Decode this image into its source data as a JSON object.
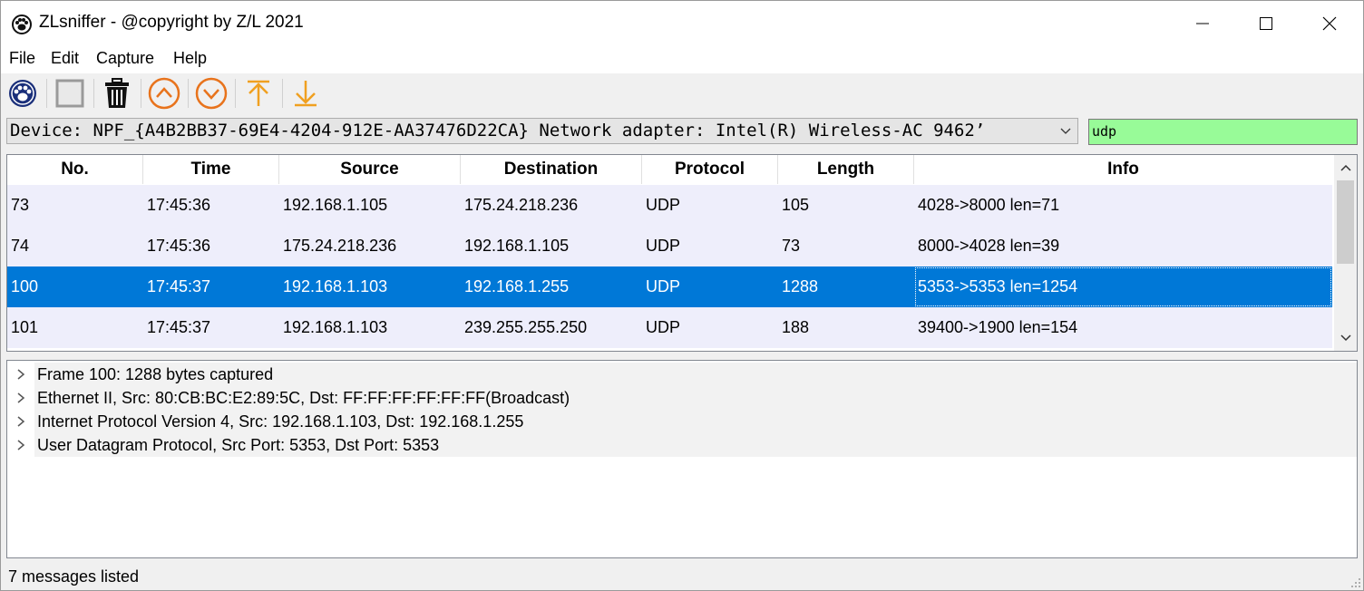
{
  "window": {
    "title": "ZLsniffer - @copyright by Z/L 2021",
    "app_icon": "paw-icon"
  },
  "menu": [
    "File",
    "Edit",
    "Capture",
    "Help"
  ],
  "toolbar": {
    "buttons": [
      "start-capture-icon",
      "stop-capture-icon",
      "trash-icon",
      "previous-packet-icon",
      "next-packet-icon",
      "first-packet-icon",
      "last-packet-icon"
    ],
    "colors": {
      "orange": "#e8731c",
      "amber": "#f0a020",
      "navy": "#1a2f7a"
    }
  },
  "device": {
    "selected": "Device: NPF_{A4B2BB37-69E4-4204-912E-AA37476D22CA}   Network adapter: Intel(R) Wireless-AC 9462’"
  },
  "filter": {
    "value": "udp",
    "background": "#98fb98"
  },
  "table": {
    "columns": [
      "No.",
      "Time",
      "Source",
      "Destination",
      "Protocol",
      "Length",
      "Info"
    ],
    "rows": [
      {
        "no": "73",
        "time": "17:45:36",
        "source": "192.168.1.105",
        "destination": "175.24.218.236",
        "protocol": "UDP",
        "length": "105",
        "info": "4028->8000 len=71"
      },
      {
        "no": "74",
        "time": "17:45:36",
        "source": "175.24.218.236",
        "destination": "192.168.1.105",
        "protocol": "UDP",
        "length": "73",
        "info": "8000->4028 len=39"
      },
      {
        "no": "100",
        "time": "17:45:37",
        "source": "192.168.1.103",
        "destination": "192.168.1.255",
        "protocol": "UDP",
        "length": "1288",
        "info": "5353->5353 len=1254"
      },
      {
        "no": "101",
        "time": "17:45:37",
        "source": "192.168.1.103",
        "destination": "239.255.255.250",
        "protocol": "UDP",
        "length": "188",
        "info": "39400->1900 len=154"
      }
    ],
    "selected_row_color": "#0078d7",
    "row_color": "#eeeefb"
  },
  "details": [
    "Frame  100:  1288 bytes  captured",
    "Ethernet II,  Src:  80:CB:BC:E2:89:5C,  Dst:  FF:FF:FF:FF:FF:FF(Broadcast)",
    "Internet Protocol Version 4, Src:  192.168.1.103, Dst:  192.168.1.255",
    "User Datagram Protocol, Src Port:  5353, Dst Port:  5353"
  ],
  "status": {
    "text": "7 messages listed"
  }
}
